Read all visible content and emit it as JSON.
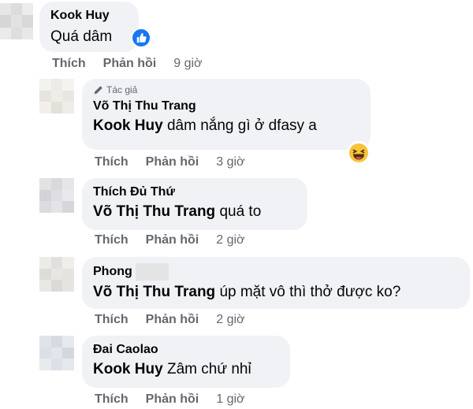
{
  "actions": {
    "like_label": "Thích",
    "reply_label": "Phản hồi"
  },
  "author_tag": "Tác giả",
  "comments": [
    {
      "author": "Kook Huy",
      "mention": "",
      "text": "Quá dâm",
      "time": "9 giờ"
    },
    {
      "author": "Võ Thị Thu Trang",
      "mention": "Kook Huy",
      "text": "dâm nắng gì ở dfasy a",
      "time": "3 giờ"
    },
    {
      "author": "Thích Đủ Thứ",
      "mention": "Võ Thị Thu Trang",
      "text": "quá to",
      "time": "2 giờ"
    },
    {
      "author": "Phong",
      "mention": "Võ Thị Thu Trang",
      "text": "úp mặt vô thì thở được ko?",
      "time": "2 giờ"
    },
    {
      "author": "Đai Caolao",
      "mention": "Kook Huy",
      "text": "Zâm chứ nhỉ",
      "time": "1 giờ"
    }
  ],
  "colors": {
    "bubble": "#f0f2f5",
    "meta_text": "#65676b",
    "like_blue": "#1877f2",
    "haha_yellow": "#f7c33b"
  },
  "icons": {
    "author_tag": "pencil-icon",
    "reaction_like": "like-reaction-icon",
    "reaction_haha": "haha-reaction-icon"
  }
}
